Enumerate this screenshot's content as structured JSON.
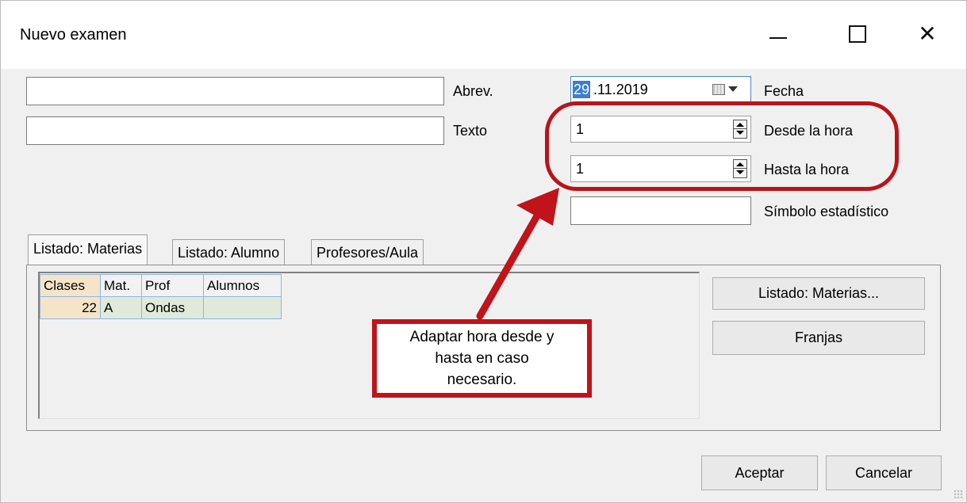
{
  "window": {
    "title": "Nuevo examen",
    "controls": {
      "minimize": "minimize-icon",
      "maximize": "maximize-icon",
      "close": "close-icon"
    }
  },
  "form": {
    "abrev": {
      "label": "Abrev.",
      "value": ""
    },
    "texto": {
      "label": "Texto",
      "value": ""
    },
    "fecha": {
      "label": "Fecha",
      "day": "29",
      "rest": ".11.2019"
    },
    "desde": {
      "label": "Desde la hora",
      "value": "1"
    },
    "hasta": {
      "label": "Hasta la hora",
      "value": "1"
    },
    "simbolo": {
      "label": "Símbolo estadístico",
      "value": ""
    }
  },
  "tabs": [
    {
      "label": "Listado: Materias",
      "active": true
    },
    {
      "label": "Listado: Alumno",
      "active": false
    },
    {
      "label": "Profesores/Aula",
      "active": false
    }
  ],
  "grid": {
    "headers": [
      "Clases",
      "Mat.",
      "Prof",
      "Alumnos"
    ],
    "rows": [
      [
        "22",
        "A",
        "Ondas",
        ""
      ]
    ]
  },
  "side_buttons": {
    "materias": "Listado: Materias...",
    "franjas": "Franjas"
  },
  "footer": {
    "accept": "Aceptar",
    "cancel": "Cancelar"
  },
  "annotation": {
    "text_line1": "Adaptar hora desde y",
    "text_line2": "hasta en caso",
    "text_line3": "necesario.",
    "color": "#c0131a"
  }
}
